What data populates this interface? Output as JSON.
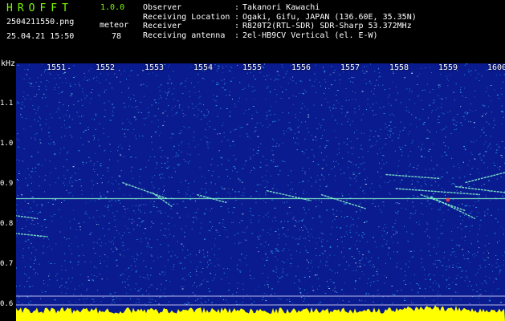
{
  "brand": {
    "name": "HROFFT",
    "version": "1.0.0"
  },
  "file_name": "2504211550.png",
  "date_time": "25.04.21 15:50",
  "meteor": {
    "label": "meteor",
    "count": "78"
  },
  "info": [
    {
      "label": "Observer",
      "value": "Takanori Kawachi"
    },
    {
      "label": "Receiving Location",
      "value": "Ogaki, Gifu, JAPAN (136.60E, 35.35N)"
    },
    {
      "label": "Receiver",
      "value": "R820T2(RTL-SDR) SDR-Sharp 53.372MHz"
    },
    {
      "label": "Receiving antenna",
      "value": "2el-HB9CV Vertical (el. E-W)"
    }
  ],
  "chart_data": {
    "type": "heatmap",
    "xlabel": "",
    "ylabel": "kHz",
    "x_ticks": [
      "1551",
      "1552",
      "1553",
      "1554",
      "1555",
      "1556",
      "1557",
      "1558",
      "1559",
      "1600"
    ],
    "y_ticks": [
      "1.1",
      "1.0",
      "0.9",
      "0.8",
      "0.7",
      "0.6"
    ],
    "ylim": [
      0.58,
      1.2
    ],
    "carrier_khz": 0.865,
    "reference_lines_khz": [
      0.622,
      0.6
    ],
    "background_color": "#0a1b8f",
    "noise_color": "#2ec4ff",
    "signal_color": "#8cffd0",
    "baseline_color": "#ffff00",
    "echoes": [
      {
        "x1": 1552.3,
        "y1": 0.905,
        "x2": 1553.2,
        "y2": 0.865
      },
      {
        "x1": 1552.9,
        "y1": 0.88,
        "x2": 1553.3,
        "y2": 0.845
      },
      {
        "x1": 1553.8,
        "y1": 0.875,
        "x2": 1554.4,
        "y2": 0.855
      },
      {
        "x1": 1555.2,
        "y1": 0.885,
        "x2": 1556.1,
        "y2": 0.86
      },
      {
        "x1": 1556.3,
        "y1": 0.875,
        "x2": 1557.2,
        "y2": 0.84
      },
      {
        "x1": 1557.6,
        "y1": 0.925,
        "x2": 1558.7,
        "y2": 0.915
      },
      {
        "x1": 1557.8,
        "y1": 0.89,
        "x2": 1559.5,
        "y2": 0.875
      },
      {
        "x1": 1558.3,
        "y1": 0.875,
        "x2": 1559.2,
        "y2": 0.835
      },
      {
        "x1": 1558.5,
        "y1": 0.87,
        "x2": 1559.4,
        "y2": 0.815
      },
      {
        "x1": 1559.0,
        "y1": 0.895,
        "x2": 1560.0,
        "y2": 0.88
      },
      {
        "x1": 1559.2,
        "y1": 0.905,
        "x2": 1560.0,
        "y2": 0.93
      },
      {
        "x1": 1550.0,
        "y1": 0.825,
        "x2": 1550.6,
        "y2": 0.815
      },
      {
        "x1": 1550.0,
        "y1": 0.78,
        "x2": 1550.8,
        "y2": 0.77
      }
    ]
  }
}
